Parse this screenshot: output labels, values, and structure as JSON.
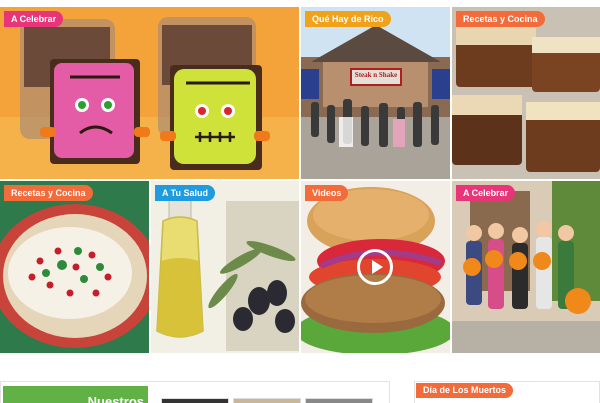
{
  "colors": {
    "orange": "#f26b3a",
    "pink": "#e8357a",
    "yellow": "#f0a21a",
    "blue": "#1f9be0",
    "green": "#62b146"
  },
  "tiles": [
    {
      "tag": "A Celebrar",
      "tag_color": "#e8357a",
      "image": "halloween-brownies"
    },
    {
      "tag": "Qué Hay de Rico",
      "tag_color": "#f0a21a",
      "image": "steak-n-shake-crowd"
    },
    {
      "tag": "Recetas y Cocina",
      "tag_color": "#f26b3a",
      "image": "cheesecake-brownies"
    },
    {
      "tag": "Recetas y Cocina",
      "tag_color": "#f26b3a",
      "image": "chiles-en-nogada"
    },
    {
      "tag": "A Tu Salud",
      "tag_color": "#1f9be0",
      "image": "olive-oil-bottle"
    },
    {
      "tag": "Videos",
      "tag_color": "#f26b3a",
      "image": "veggie-burger",
      "has_play": true
    },
    {
      "tag": "A Celebrar",
      "tag_color": "#e8357a",
      "image": "kids-halloween-costumes"
    }
  ],
  "storefront_sign": "Steak n Shake",
  "bottom": {
    "left_heading": "Nuestros",
    "right_tag": "Día de Los Muertos",
    "right_tag_color": "#f26b3a"
  }
}
